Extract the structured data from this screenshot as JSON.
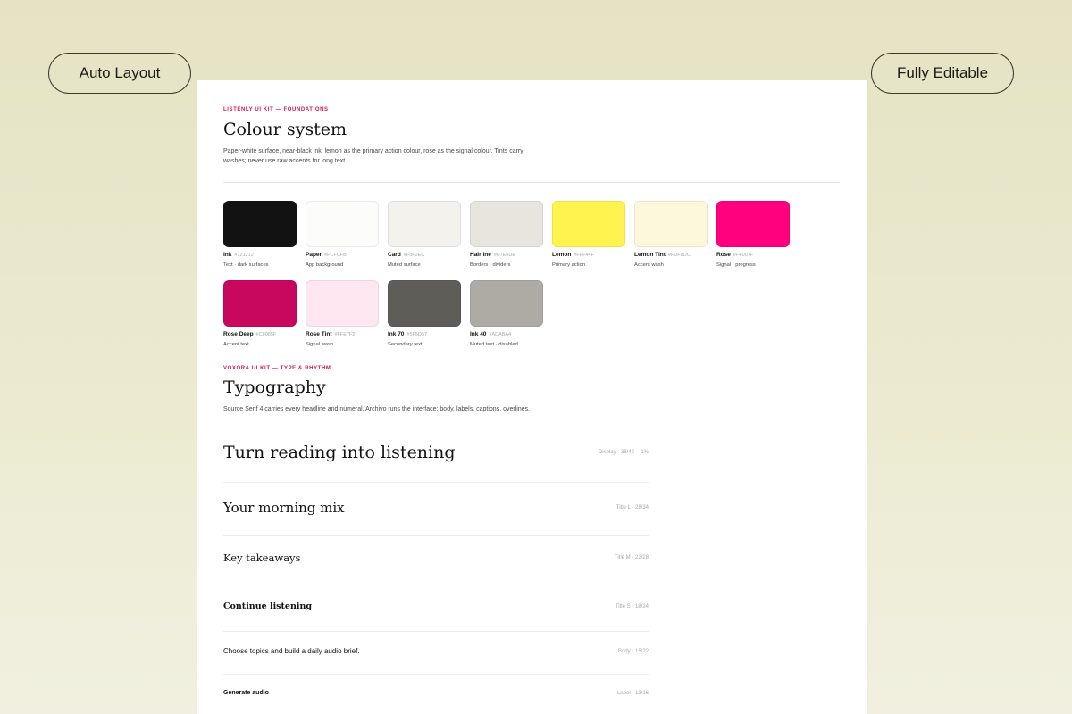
{
  "badges": {
    "left": "Auto Layout",
    "right": "Fully Editable"
  },
  "colour_section": {
    "overline": "LISTENLY UI KIT — FOUNDATIONS",
    "title": "Colour system",
    "description": "Paper-white surface, near-black ink, lemon as the primary action colour, rose as the signal colour. Tints carry washes; never use raw accents for long text."
  },
  "swatches": [
    {
      "name": "Ink",
      "hex": "#121212",
      "role": "Text · dark surfaces",
      "color": "#121212"
    },
    {
      "name": "Paper",
      "hex": "#FCFCFB",
      "role": "App background",
      "color": "#FCFCFB"
    },
    {
      "name": "Card",
      "hex": "#F3F2EC",
      "role": "Muted surface",
      "color": "#F3F2EC"
    },
    {
      "name": "Hairline",
      "hex": "#E7E5DE",
      "role": "Borders · dividers",
      "color": "#E7E5DE"
    },
    {
      "name": "Lemon",
      "hex": "#FFF44F",
      "role": "Primary action",
      "color": "#FFF44F"
    },
    {
      "name": "Lemon Tint",
      "hex": "#FDF8DC",
      "role": "Accent wash",
      "color": "#FDF8DC"
    },
    {
      "name": "Rose",
      "hex": "#FF007F",
      "role": "Signal · progress",
      "color": "#FF007F"
    },
    {
      "name": "Rose Deep",
      "hex": "#C8085F",
      "role": "Accent text",
      "color": "#C8085F"
    },
    {
      "name": "Rose Tint",
      "hex": "#FFE7F2",
      "role": "Signal wash",
      "color": "#FFE7F2"
    },
    {
      "name": "Ink 70",
      "hex": "#5F5D57",
      "role": "Secondary text",
      "color": "#5F5D57"
    },
    {
      "name": "Ink 40",
      "hex": "#ADABA4",
      "role": "Muted text · disabled",
      "color": "#ADABA4"
    }
  ],
  "type_section": {
    "overline": "VOXORA UI KIT — TYPE & RHYTHM",
    "title": "Typography",
    "description": "Source Serif 4 carries every headline and numeral. Archivo runs the interface: body, labels, captions, overlines."
  },
  "type_scale": [
    {
      "sample": "Turn reading into listening",
      "spec": "Display · 36/42 · -1%"
    },
    {
      "sample": "Your morning mix",
      "spec": "Title L · 28/34"
    },
    {
      "sample": "Key takeaways",
      "spec": "Title M · 22/28"
    },
    {
      "sample": "Continue listening",
      "spec": "Title S · 18/24"
    },
    {
      "sample": "Choose topics and build a daily audio brief.",
      "spec": "Body · 15/22"
    },
    {
      "sample": "Generate audio",
      "spec": "Label · 13/16"
    }
  ]
}
